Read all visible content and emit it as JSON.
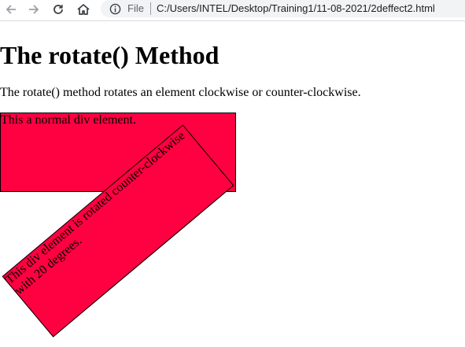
{
  "browser": {
    "scheme_label": "File",
    "url": "C:/Users/INTEL/Desktop/Training1/11-08-2021/2deffect2.html",
    "icons": {
      "back": "back-arrow-icon",
      "forward": "forward-arrow-icon",
      "reload": "reload-icon",
      "home": "home-icon",
      "info": "info-icon"
    }
  },
  "page": {
    "title": "The rotate() Method",
    "description": "The rotate() method rotates an element clockwise or counter-clockwise.",
    "normal_div_text": "This a normal div element.",
    "rotated_div_text": "This div element is rotated counter-clockwise with 20 degrees."
  },
  "colors": {
    "box_fill": "#ff0040",
    "box_border": "#000000"
  }
}
